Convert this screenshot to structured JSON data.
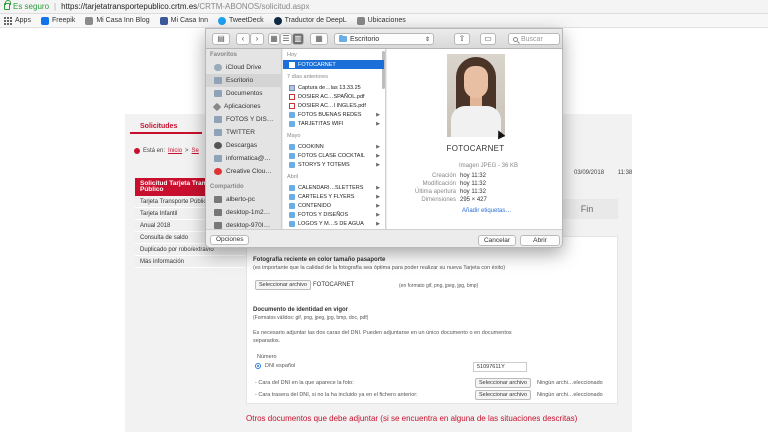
{
  "browser": {
    "secure_label": "Es seguro",
    "url_host": "https://tarjetatransportepublico.crtm.es",
    "url_path": "/CRTM-ABONOS/solicitud.aspx",
    "bookmarks": [
      "Apps",
      "Freepik",
      "Mi Casa Inn Blog",
      "Mi Casa Inn",
      "TweetDeck",
      "Traductor de DeepL",
      "Ubicaciones"
    ]
  },
  "page": {
    "tab_solicitudes": "Solicitudes",
    "breadcrumb": {
      "prefix": "Está en:",
      "link1": "Inicio",
      "sep": ">",
      "link2": "Se"
    },
    "sidenav": {
      "title": "Solicitud Tarjeta Transporte Público",
      "items": [
        "Tarjeta Transporte Públic",
        "Tarjeta Infantil",
        "Anual 2018",
        "Consulta de saldo",
        "Duplicado por robo/extravío",
        "Más información"
      ]
    },
    "date": "03/09/2018",
    "time": "11:38",
    "fin_label": "Fin",
    "form": {
      "photo_heading": "Fotografía reciente en color tamaño pasaporte",
      "photo_note": "(es importante que la calidad de la fotografía sea óptima para poder realizar su nueva Tarjeta con éxito)",
      "select_file": "Seleccionar archivo",
      "photo_file": "FOTOCARNET",
      "photo_formats": "(en formato gif, png, jpeg, jpg, bmp)",
      "id_heading": "Documento de identidad en vigor",
      "id_formats": "(Formatos válidos: gif, png, jpeg, jpg, bmp, doc, pdf)",
      "id_note_1": "Es necesario adjuntar las dos caras del DNI. Pueden adjuntarse en un único documento o en documentos",
      "id_note_2": "separados.",
      "numero_label": "Número",
      "dni_label": "DNI español",
      "dni_value": "51097611Y",
      "front_label": "- Cara del DNI en la que aparece la foto:",
      "back_label": "- Cara trasera del DNI, si no la ha incluido ya en el fichero anterior:",
      "no_file_front": "Ningún archi…eleccionado",
      "no_file_back": "Ningún archi…eleccionado"
    },
    "otros": "Otros documentos que debe adjuntar (si se encuentra en alguna de las situaciones descritas)"
  },
  "dialog": {
    "location": "Escritorio",
    "search_placeholder": "Buscar",
    "sidebar": {
      "favoritos_label": "Favoritos",
      "favoritos": [
        "iCloud Drive",
        "Escritorio",
        "Documentos",
        "Aplicaciones",
        "FOTOS Y DIS…",
        "TWITTER",
        "Descargas",
        "informatica@…",
        "Creative Clou…"
      ],
      "compartido_label": "Compartido",
      "compartido": [
        "alberto-pc",
        "desktop-1m2…",
        "desktop-970I…"
      ]
    },
    "list": {
      "group_hoy": "Hoy",
      "hoy": [
        "FOTOCARNET"
      ],
      "group_7dias": "7 días anteriores",
      "siete": [
        "Captura de…las 13.33.25",
        "DOSIER AC…SPAÑOL.pdf",
        "DOSIER AC…I INGLES.pdf",
        "FOTOS BUENAS REDES",
        "TARJETITAS WIFI"
      ],
      "group_mayo": "Mayo",
      "mayo": [
        "COOKINN",
        "FOTOS CLASE COCKTAIL",
        "STORYS Y TOTEMS"
      ],
      "group_abril": "Abril",
      "abril": [
        "CALENDARI…SLETTERS",
        "CARTELES Y FLYERS",
        "CONTENIDO",
        "FOTOS Y DISEÑOS",
        "LOGOS Y M…S DE AGUA"
      ]
    },
    "preview": {
      "name": "FOTOCARNET",
      "kind": "Imagen JPEG - 36 KB",
      "rows": [
        {
          "k": "Creación",
          "v": "hoy 11:32"
        },
        {
          "k": "Modificación",
          "v": "hoy 11:32"
        },
        {
          "k": "Última apertura",
          "v": "hoy 11:32"
        },
        {
          "k": "Dimensiones",
          "v": "295 × 427"
        }
      ],
      "tags_link": "Añadir etiquetas…"
    },
    "footer": {
      "options": "Opciones",
      "cancel": "Cancelar",
      "open": "Abrir"
    }
  }
}
